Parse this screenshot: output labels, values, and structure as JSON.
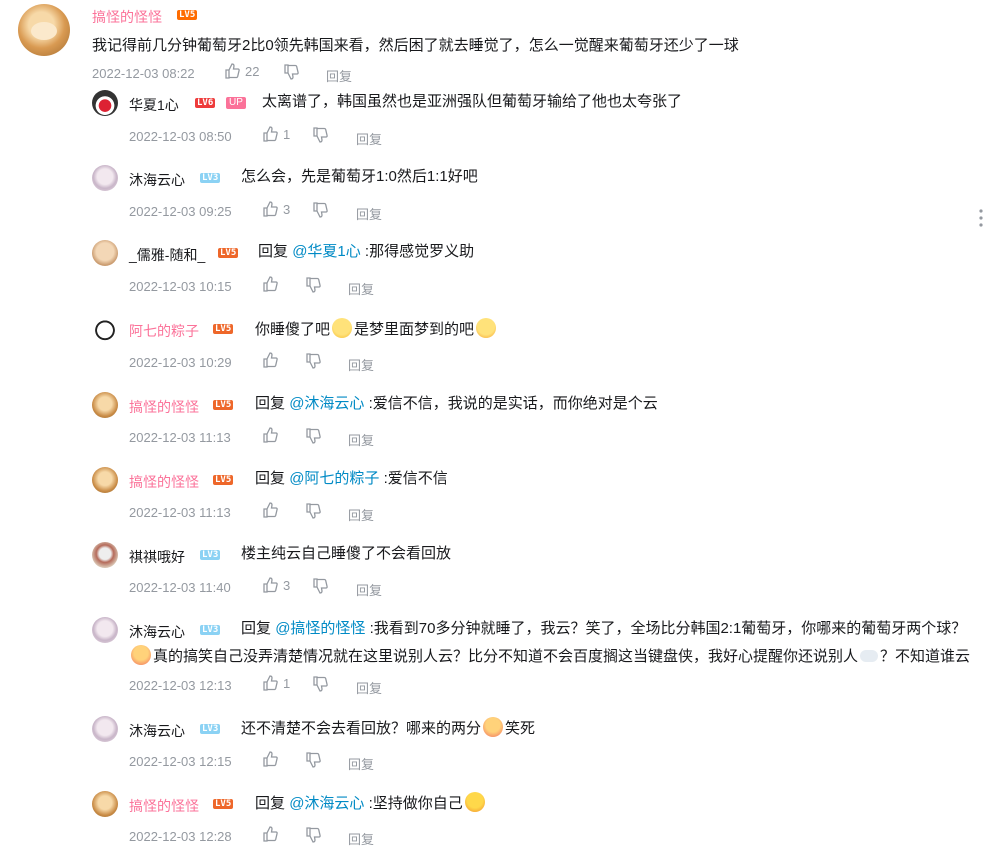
{
  "main_comment": {
    "username": "搞怪的怪怪",
    "level": "LV5",
    "text": "我记得前几分钟葡萄牙2比0领先韩国来看，然后困了就去睡觉了，怎么一觉醒来葡萄牙还少了一球",
    "date": "2022-12-03 08:22",
    "likes": "22",
    "reply_label": "回复"
  },
  "replies": [
    {
      "username": "华夏1心",
      "level": "LV6",
      "badge": "UP",
      "text": "太离谱了，韩国虽然也是亚洲强队但葡萄牙输给了他也太夸张了",
      "date": "2022-12-03 08:50",
      "likes": "1",
      "reply_label": "回复"
    },
    {
      "username": "沐海云心",
      "level": "LV3",
      "text": "怎么会，先是葡萄牙1:0然后1:1好吧",
      "date": "2022-12-03 09:25",
      "likes": "3",
      "reply_label": "回复"
    },
    {
      "username": "_儒雅-随和_",
      "level": "LV5",
      "prefix": "回复",
      "mention": "@华夏1心",
      "text": " :那得感觉罗义助",
      "date": "2022-12-03 10:15",
      "likes": "",
      "reply_label": "回复"
    },
    {
      "username": "阿七的粽子",
      "level": "LV5",
      "text_a": "你睡傻了吧",
      "text_b": "是梦里面梦到的吧",
      "date": "2022-12-03 10:29",
      "likes": "",
      "reply_label": "回复"
    },
    {
      "username": "搞怪的怪怪",
      "level": "LV5",
      "prefix": "回复",
      "mention": "@沐海云心",
      "text": " :爱信不信，我说的是实话，而你绝对是个云",
      "date": "2022-12-03 11:13",
      "likes": "",
      "reply_label": "回复"
    },
    {
      "username": "搞怪的怪怪",
      "level": "LV5",
      "prefix": "回复",
      "mention": "@阿七的粽子",
      "text": " :爱信不信",
      "date": "2022-12-03 11:13",
      "likes": "",
      "reply_label": "回复"
    },
    {
      "username": "祺祺哦好",
      "level": "LV3",
      "text": "楼主纯云自己睡傻了不会看回放",
      "date": "2022-12-03 11:40",
      "likes": "3",
      "reply_label": "回复"
    },
    {
      "username": "沐海云心",
      "level": "LV3",
      "prefix": "回复",
      "mention": "@搞怪的怪怪",
      "text": " :我看到70多分钟就睡了，我云？笑了，全场比分韩国2:1葡萄牙，你哪来的葡萄牙两个球？",
      "line2_a": "真的搞笑自己没弄清楚情况就在这里说别人云？比分不知道不会百度搁这当键盘侠，我好心提醒你还说别人",
      "line2_b": "？不知道谁云",
      "date": "2022-12-03 12:13",
      "likes": "1",
      "reply_label": "回复"
    },
    {
      "username": "沐海云心",
      "level": "LV3",
      "text_a": "还不清楚不会去看回放？哪来的两分",
      "text_b": "笑死",
      "date": "2022-12-03 12:15",
      "likes": "",
      "reply_label": "回复"
    },
    {
      "username": "搞怪的怪怪",
      "level": "LV5",
      "prefix": "回复",
      "mention": "@沐海云心",
      "text": " :坚持做你自己",
      "date": "2022-12-03 12:28",
      "likes": "",
      "reply_label": "回复"
    }
  ],
  "icons": {
    "like": "thumbs-up-icon",
    "dislike": "thumbs-down-icon",
    "more": "more-vertical-icon"
  },
  "colors": {
    "username_pink": "#fb7299",
    "mention_blue": "#008ac5",
    "meta_gray": "#9499a0"
  }
}
